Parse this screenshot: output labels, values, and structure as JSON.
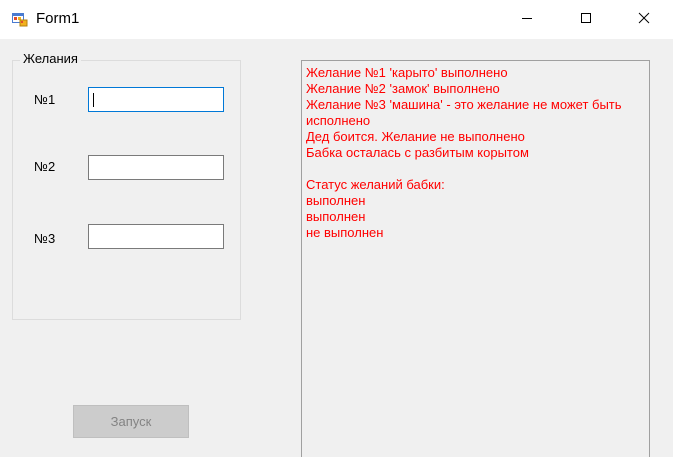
{
  "window": {
    "title": "Form1",
    "icon": "winforms-app-icon",
    "controls": {
      "minimize_icon": "minimize-icon",
      "maximize_icon": "maximize-icon",
      "close_icon": "close-icon"
    }
  },
  "wishes_group": {
    "caption": "Желания",
    "fields": [
      {
        "label": "№1",
        "value": "",
        "focused": true
      },
      {
        "label": "№2",
        "value": "",
        "focused": false
      },
      {
        "label": "№3",
        "value": "",
        "focused": false
      }
    ]
  },
  "run_button": {
    "label": "Запуск",
    "enabled": false
  },
  "output": {
    "text_color": "#ff0000",
    "lines": [
      "Желание №1 'карыто' выполнено",
      "Желание №2 'замок' выполнено",
      "Желание №3 'машина' - это желание не может быть",
      "исполнено",
      "Дед боится. Желание не выполнено",
      "Бабка осталась с разбитым корытом",
      "",
      "Статус желаний бабки:",
      "выполнен",
      "выполнен",
      "не выполнен"
    ]
  }
}
